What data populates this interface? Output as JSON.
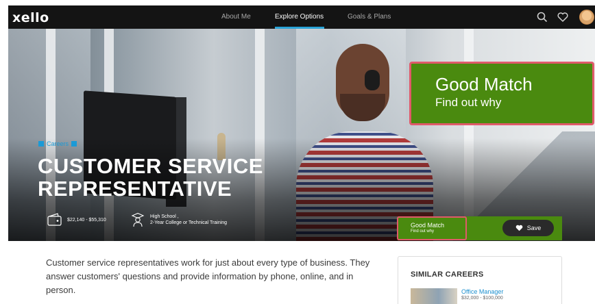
{
  "nav": {
    "logo": "xello",
    "items": [
      {
        "label": "About Me",
        "active": false
      },
      {
        "label": "Explore Options",
        "active": true
      },
      {
        "label": "Goals & Plans",
        "active": false
      }
    ],
    "icons": [
      "search-icon",
      "heart-icon",
      "avatar"
    ]
  },
  "hero": {
    "tag": "Careers",
    "title_line1": "CUSTOMER SERVICE",
    "title_line2": "REPRESENTATIVE",
    "salary": "$22,140 - $55,310",
    "education_line1": "High School ,",
    "education_line2": "2-Year College or Technical Training"
  },
  "match": {
    "heading": "Good Match",
    "subheading": "Find out why"
  },
  "save_label": "Save",
  "description": "Customer service representatives work for just about every type of business. They answer customers' questions and provide information by phone, online, and in person.",
  "similar": {
    "heading": "SIMILAR CAREERS",
    "items": [
      {
        "title": "Office Manager",
        "salary": "$32,000 - $100,000"
      }
    ]
  },
  "colors": {
    "nav_bg": "#141414",
    "accent_blue": "#2aa4d8",
    "match_green": "#4a8a0f",
    "highlight_border": "#e05a6a"
  }
}
